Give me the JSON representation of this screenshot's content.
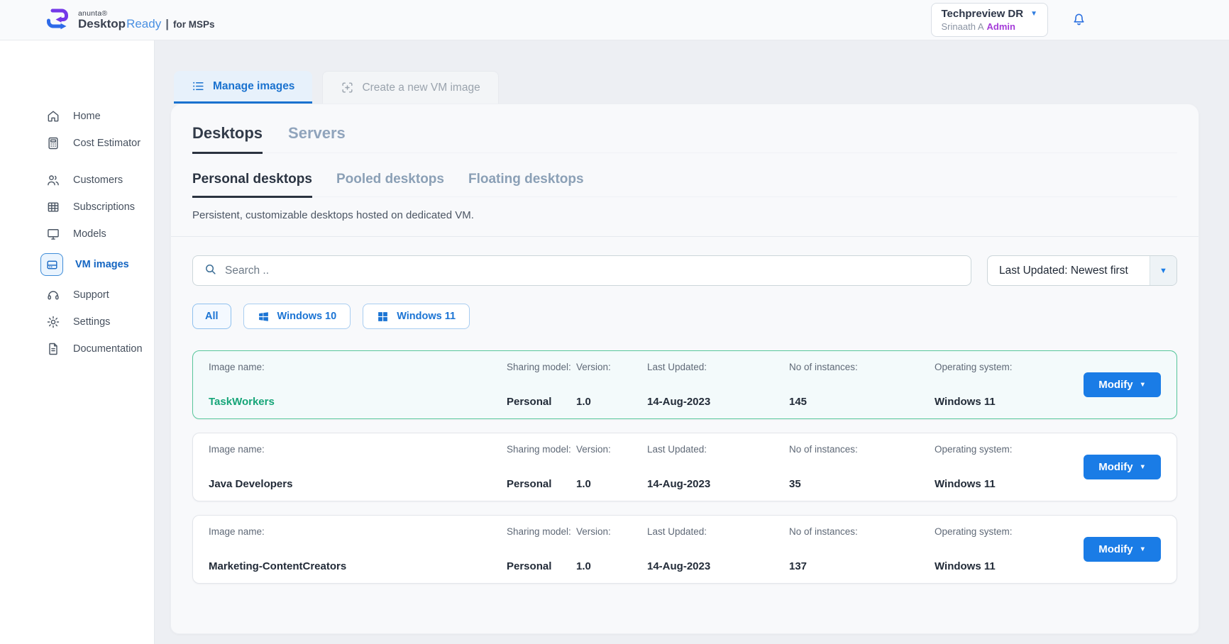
{
  "header": {
    "brand": {
      "company": "anunta®",
      "product_primary": "Desktop",
      "product_accent": "Ready",
      "separator": "|",
      "suffix": "for MSPs"
    },
    "account": {
      "tenant": "Techpreview DR",
      "user": "Srinaath A",
      "role": "Admin"
    }
  },
  "sidebar": {
    "items": [
      {
        "label": "Home"
      },
      {
        "label": "Cost Estimator"
      },
      {
        "label": "Customers"
      },
      {
        "label": "Subscriptions"
      },
      {
        "label": "Models"
      },
      {
        "label": "VM images"
      },
      {
        "label": "Support"
      },
      {
        "label": "Settings"
      },
      {
        "label": "Documentation"
      }
    ]
  },
  "tabs": {
    "manage_label": "Manage images",
    "create_label": "Create a new VM image"
  },
  "panel": {
    "category_tabs": {
      "desktops": "Desktops",
      "servers": "Servers"
    },
    "type_tabs": {
      "personal": "Personal desktops",
      "pooled": "Pooled desktops",
      "floating": "Floating desktops"
    },
    "description": "Persistent, customizable desktops hosted on dedicated VM."
  },
  "toolbar": {
    "search_placeholder": "Search ..",
    "sort_label": "Last Updated: Newest first"
  },
  "filters": {
    "all": "All",
    "win10": "Windows 10",
    "win11": "Windows 11"
  },
  "list": {
    "labels": {
      "image_name": "Image name:",
      "sharing_model": "Sharing model:",
      "version": "Version:",
      "last_updated": "Last Updated:",
      "instances": "No of instances:",
      "os": "Operating system:"
    },
    "modify_label": "Modify",
    "rows": [
      {
        "name": "TaskWorkers",
        "sharing": "Personal",
        "version": "1.0",
        "updated": "14-Aug-2023",
        "instances": "145",
        "os": "Windows 11"
      },
      {
        "name": "Java Developers",
        "sharing": "Personal",
        "version": "1.0",
        "updated": "14-Aug-2023",
        "instances": "35",
        "os": "Windows 11"
      },
      {
        "name": "Marketing-ContentCreators",
        "sharing": "Personal",
        "version": "1.0",
        "updated": "14-Aug-2023",
        "instances": "137",
        "os": "Windows 11"
      }
    ]
  },
  "icons": {
    "caret_down": "▼"
  },
  "colors": {
    "accent_blue": "#1a7ce6",
    "active_tab_blue": "#1a72cf",
    "selected_green": "#16a578",
    "selected_border_green": "#57c79b",
    "admin_purple": "#a43bd8"
  }
}
